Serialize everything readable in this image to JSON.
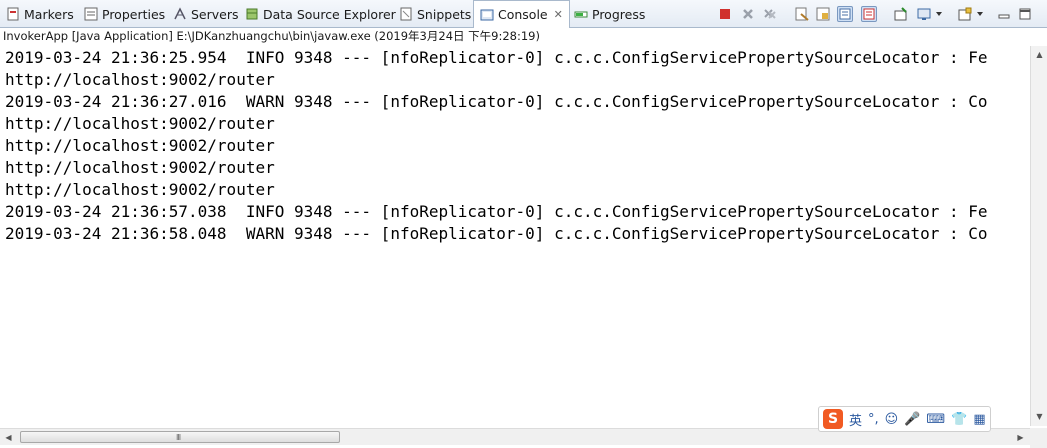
{
  "tabs": [
    {
      "label": "Markers",
      "icon": "markers-icon",
      "active": false
    },
    {
      "label": "Properties",
      "icon": "properties-icon",
      "active": false
    },
    {
      "label": "Servers",
      "icon": "servers-icon",
      "active": false
    },
    {
      "label": "Data Source Explorer",
      "icon": "data-source-icon",
      "active": false
    },
    {
      "label": "Snippets",
      "icon": "snippets-icon",
      "active": false
    },
    {
      "label": "Console",
      "icon": "console-icon",
      "active": true,
      "close": "✕"
    },
    {
      "label": "Progress",
      "icon": "progress-icon",
      "active": false
    }
  ],
  "toolbar": {
    "terminate_icon": "terminate-icon",
    "remove_launch_icon": "remove-launch-icon",
    "remove_all_icon": "remove-all-terminated-icon",
    "clear_console_icon": "clear-console-icon",
    "scroll_lock_icon": "scroll-lock-icon",
    "show_stdout_icon": "show-on-stdout-icon",
    "show_stderr_icon": "show-on-stderr-icon",
    "pin_console_icon": "pin-console-icon",
    "display_console_icon": "display-selected-console-icon",
    "open_console_icon": "open-console-icon",
    "minimize_icon": "minimize-icon",
    "maximize_icon": "maximize-icon"
  },
  "subtitle": "InvokerApp [Java Application] E:\\JDKanzhuangchu\\bin\\javaw.exe (2019年3月24日 下午9:28:19)",
  "console_lines": [
    "2019-03-24 21:36:25.954  INFO 9348 --- [nfoReplicator-0] c.c.c.ConfigServicePropertySourceLocator : Fe",
    "http://localhost:9002/router",
    "2019-03-24 21:36:27.016  WARN 9348 --- [nfoReplicator-0] c.c.c.ConfigServicePropertySourceLocator : Co",
    "http://localhost:9002/router",
    "http://localhost:9002/router",
    "http://localhost:9002/router",
    "http://localhost:9002/router",
    "2019-03-24 21:36:57.038  INFO 9348 --- [nfoReplicator-0] c.c.c.ConfigServicePropertySourceLocator : Fe",
    "2019-03-24 21:36:58.048  WARN 9348 --- [nfoReplicator-0] c.c.c.ConfigServicePropertySourceLocator : Co"
  ],
  "scrollbar": {
    "grip": "III",
    "left_arrow": "◀",
    "right_arrow": "▶",
    "up_arrow": "▲",
    "down_arrow": "▼"
  },
  "ime": {
    "logo": "S",
    "mode": "英",
    "punct": "°,",
    "emoji": "☺",
    "mic": "🎤",
    "keyboard": "⌨",
    "skin": "👕",
    "grid": "▦"
  },
  "colors": {
    "terminate": "#d0312d",
    "accent": "#2c5aa0"
  }
}
